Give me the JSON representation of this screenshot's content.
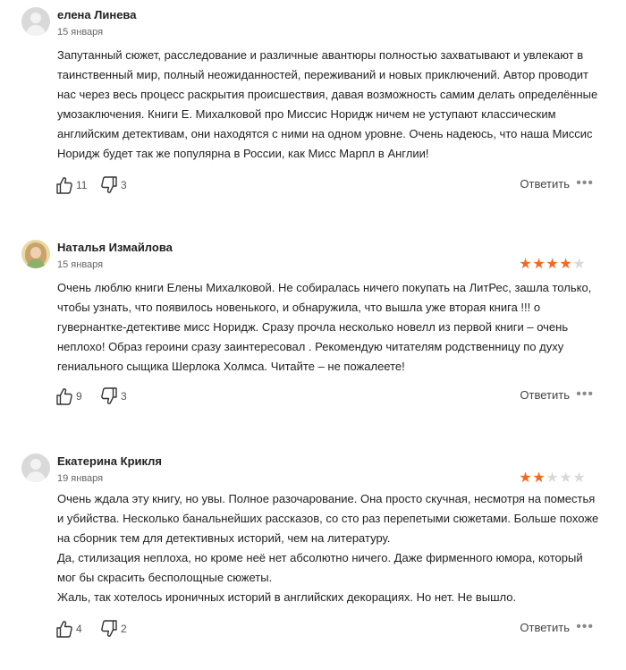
{
  "reviews": [
    {
      "author": "елена Линева",
      "date": "15 января",
      "rating": null,
      "paragraphs": [
        "Запутанный сюжет, расследование и различные авантюры полностью захватывают и увлекают в таинственный мир, полный неожиданностей, переживаний и новых приключений. Автор проводит нас через весь процесс раскрытия происшествия, давая возможность самим делать определённые умозаключения. Книги Е. Михалковой про Миссис Норидж ничем не уступают классическим английским детективам, они находятся с ними на одном уровне. Очень надеюсь, что наша Миссис Норидж будет так же популярна в России, как Мисс Марпл в Англии!"
      ],
      "likes": "11",
      "dislikes": "3",
      "reply_label": "Ответить",
      "more_label": "•••"
    },
    {
      "author": "Наталья Измайлова",
      "date": "15 января",
      "rating": 4,
      "paragraphs": [
        "Очень люблю книги Елены Михалковой. Не собиралась ничего покупать на ЛитРес, зашла только, чтобы узнать, что появилось новенького, и обнаружила, что вышла уже вторая книга !!! о гувернантке-детективе мисс Норидж. Сразу прочла несколько новелл из первой книги – очень неплохо! Образ героини сразу заинтересовал . Рекомендую читателям родственницу по духу гениального сыщика Шерлока Холмса. Читайте – не пожалеете!"
      ],
      "likes": "9",
      "dislikes": "3",
      "reply_label": "Ответить",
      "more_label": "•••"
    },
    {
      "author": "Екатерина Крикля",
      "date": "19 января",
      "rating": 2,
      "paragraphs": [
        "Очень ждала эту книгу, но увы. Полное разочарование. Она просто скучная, несмотря на поместья и убийства. Несколько банальнейших рассказов, со сто раз перепетыми сюжетами. Больше похоже на сборник тем для детективных историй, чем на литературу.",
        "Да, стилизация неплоха, но кроме неё нет абсолютно ничего. Даже фирменного юмора, который мог бы скрасить бесполощные сюжеты.",
        "Жаль, так хотелось ироничных историй в английских декорациях. Но нет. Не вышло."
      ],
      "likes": "4",
      "dislikes": "2",
      "reply_label": "Ответить",
      "more_label": "•••"
    }
  ],
  "colors": {
    "star_on": "#f26a20",
    "star_off": "#d9d9d9"
  },
  "icons": {
    "like": "thumbs-up-icon",
    "dislike": "thumbs-down-icon"
  }
}
